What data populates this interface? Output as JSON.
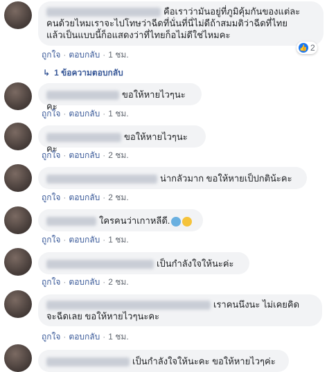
{
  "actions": {
    "like": "ถูกใจ",
    "reply": "ตอบกลับ",
    "dot": "·"
  },
  "comments": [
    {
      "text_line1": "คือเราว่ามันอยู่ที่ภูมิคุ้มกันของแต่ละ",
      "text_line2": "คนด้วยไหมเราจะไปโทษว่าฉีดที่นั่นที่นี่ไม่ดีถ้าสมมติว่าฉีดที่ไทย",
      "text_line3": "แล้วเป็นแบบนี้ก็อแสดงว่าที่ไทยก็อไม่ดีใช่ไหมคะ",
      "time": "1 ชม.",
      "reaction_count": "2"
    },
    {
      "text": "ขอให้หายไวๆนะคะ",
      "time": "1 ชม."
    },
    {
      "text": "ขอให้หายไวๆนะคะ",
      "time": "2 ชม."
    },
    {
      "text": "น่ากลัวมาก ขอให้หายเป็ปกติน้ะคะ",
      "time": "2 ชม."
    },
    {
      "text": "ใครคนว่าเกาหลีดี.",
      "time": "1 ชม."
    },
    {
      "text": "เป็นกำลังใจให้นะค่ะ",
      "time": "2 ชม."
    },
    {
      "text_line1": "เราคนนึงนะ ไม่เคยคิด",
      "text_line2": "จะฉีดเลย ขอให้หายไวๆนะคะ",
      "time": "1 ชม."
    },
    {
      "text": "เป็นกำลังใจให้นะคะ ขอให้หายไวๆค่ะ"
    }
  ],
  "reply_link": "1 ข้อความตอบกลับ",
  "reply_arrow": "↳",
  "icons": {
    "like": "thumbs-up-icon",
    "avatar": "avatar",
    "emoji1": "cold-face-emoji-icon",
    "emoji2": "crying-face-emoji-icon"
  },
  "colors": {
    "bubble": "#f2f3f5",
    "link": "#385898",
    "like_blue": "#1877f2"
  }
}
